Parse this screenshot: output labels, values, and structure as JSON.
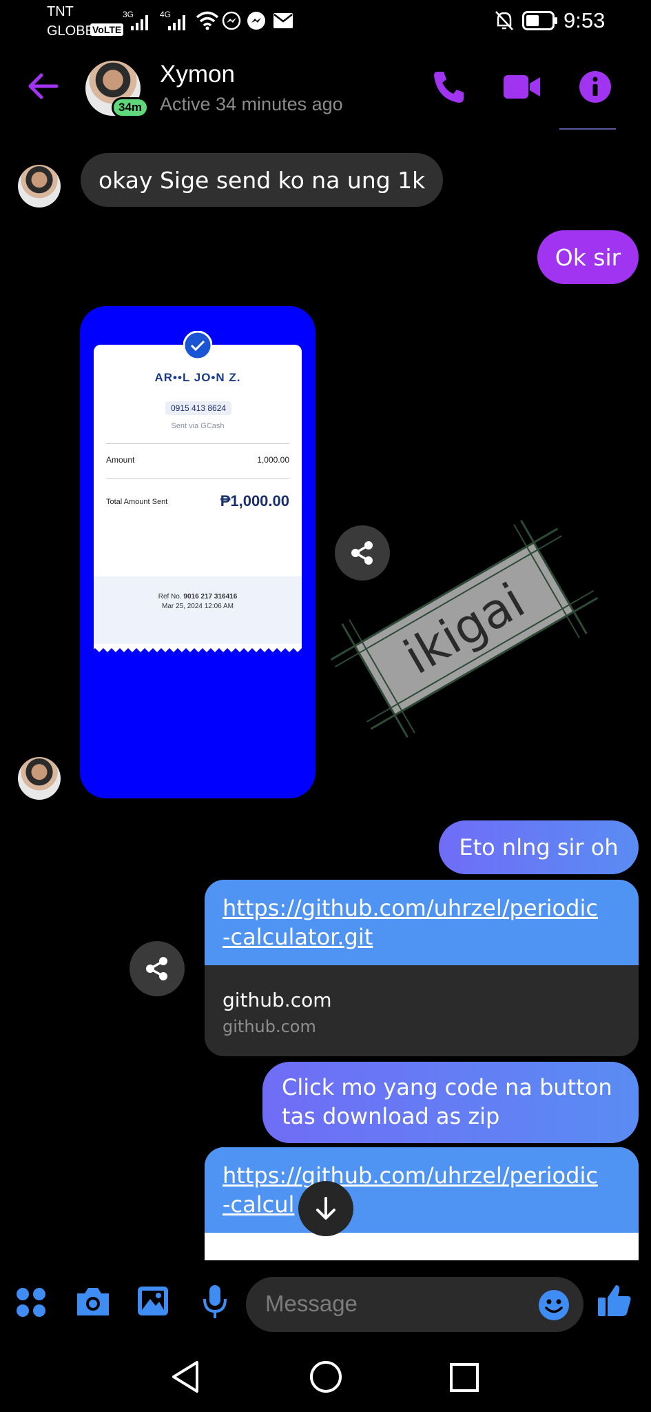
{
  "status_bar": {
    "carrier1": "TNT",
    "carrier2": "GLOBE",
    "volte": "VoLTE",
    "net1": "3G",
    "net2": "4G",
    "time": "9:53"
  },
  "header": {
    "contact_name": "Xymon",
    "active_badge": "34m",
    "status": "Active 34 minutes ago"
  },
  "messages": {
    "m1": "okay Sige send ko na ung 1k",
    "m2": "Ok sir",
    "receipt": {
      "name": "AR••L JO•N Z.",
      "phone": "0915 413 8624",
      "via": "Sent via GCash",
      "amount_label": "Amount",
      "amount_value": "1,000.00",
      "total_label": "Total Amount Sent",
      "total_value": "₱1,000.00",
      "ref_label": "Ref No.",
      "ref_value": "9016 217 316416",
      "date": "Mar 25, 2024 12:06 AM"
    },
    "sticker_text": "ikigai",
    "m3": "Eto nlng sir oh",
    "link1": {
      "url_line1": "https://github.com/uhrzel/periodic",
      "url_line2": "-calculator.git",
      "title": "github.com",
      "domain": "github.com"
    },
    "m4_line1": "Click mo yang code na button",
    "m4_line2": "tas download as zip",
    "link2": {
      "url_line1": "https://github.com/uhrzel/periodic",
      "url_line2": "-calcul"
    }
  },
  "composer": {
    "placeholder": "Message"
  },
  "colors": {
    "accent": "#a034f0",
    "link_blue": "#4f93f3",
    "icon_blue": "#3f8cf2",
    "incoming_bubble": "#303030"
  }
}
